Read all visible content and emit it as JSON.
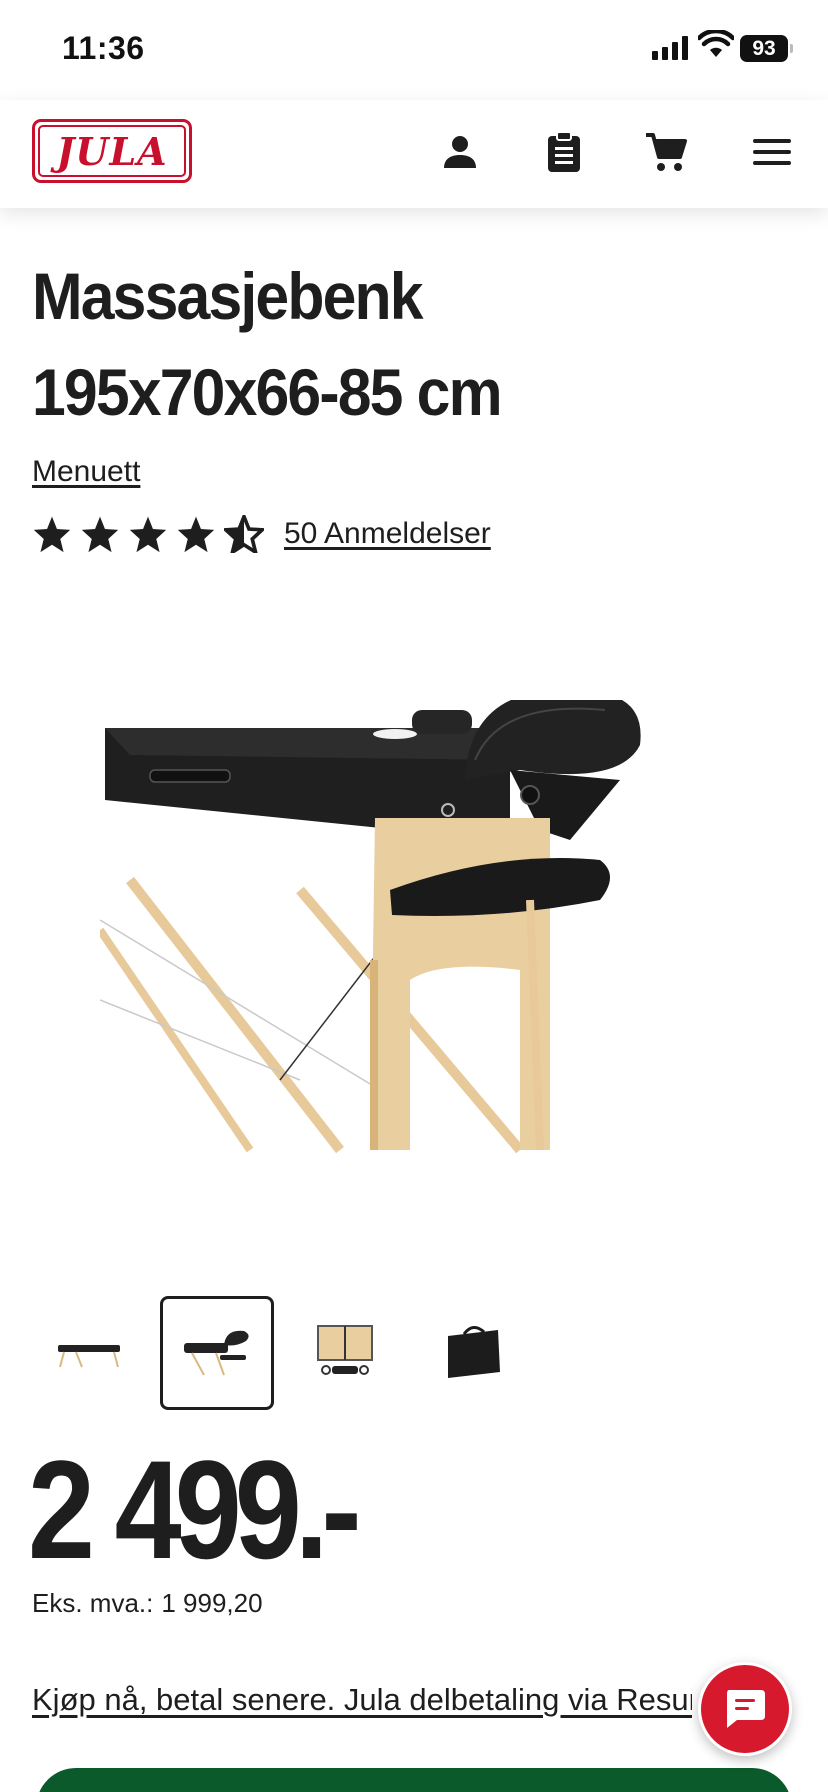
{
  "status_bar": {
    "time": "11:36",
    "battery": "93"
  },
  "header": {
    "logo_text": "JULA",
    "icons": [
      "account-icon",
      "clipboard-icon",
      "cart-icon",
      "menu-icon"
    ],
    "brand_color": "#c8102e"
  },
  "product": {
    "title": "Massasjebenk 195x70x66-85 cm",
    "brand": "Menuett",
    "rating": 4.5,
    "rating_max": 5,
    "reviews_label": "50 Anmeldelser",
    "thumbnails": [
      {
        "name": "thumb-massage-table-side"
      },
      {
        "name": "thumb-massage-table-closeup",
        "selected": true
      },
      {
        "name": "thumb-folded-table-accessories"
      },
      {
        "name": "thumb-carry-bag"
      }
    ]
  },
  "pricing": {
    "price": "2 499.-",
    "ex_vat_label": "Eks. mva.:",
    "ex_vat_value": "1 999,20"
  },
  "finance": {
    "link_text": "Kjøp nå, betal senere. Jula delbetaling via Resurs Bank"
  },
  "colors": {
    "text": "#1e1e1e",
    "chat_button": "#d7192e",
    "buy_button": "#0b5a2c"
  }
}
